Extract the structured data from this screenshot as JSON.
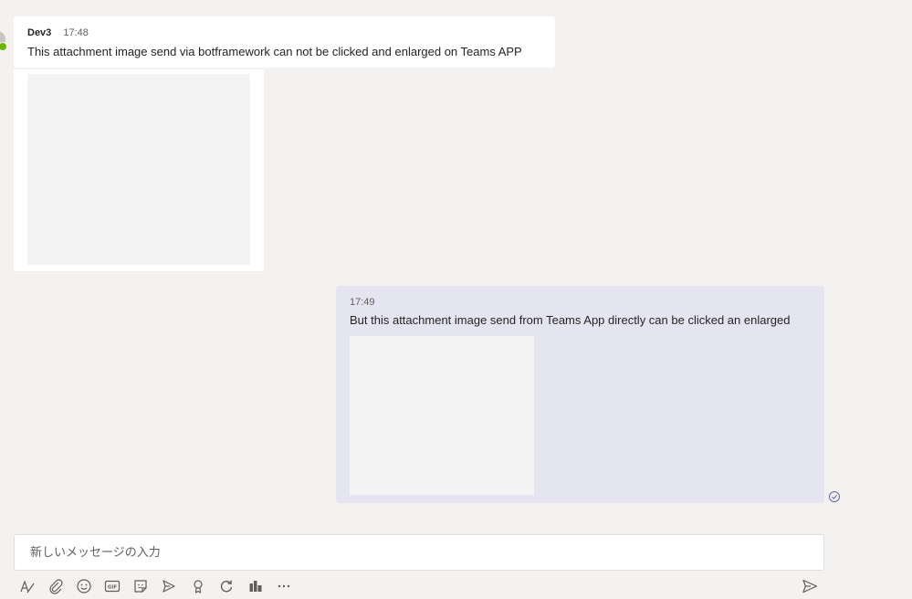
{
  "messages": [
    {
      "author": "Dev3",
      "time": "17:48",
      "text": "This attachment image send via botframework can not be clicked and enlarged on Teams APP"
    },
    {
      "time": "17:49",
      "text": "But this attachment image send from Teams App directly can be clicked an enlarged"
    }
  ],
  "compose": {
    "placeholder": "新しいメッセージの入力"
  },
  "toolbar": {
    "icons": [
      "format-icon",
      "attach-icon",
      "emoji-icon",
      "gif-icon",
      "sticker-icon",
      "meet-now-icon",
      "praise-icon",
      "loop-icon",
      "stream-icon",
      "more-options-icon"
    ],
    "send_icon": "send-icon"
  },
  "colors": {
    "background": "#f3f2f1",
    "sent_bubble": "#e5e5f1",
    "received_bubble": "#ffffff",
    "accent": "#6264a7",
    "presence_available": "#6bb700"
  }
}
